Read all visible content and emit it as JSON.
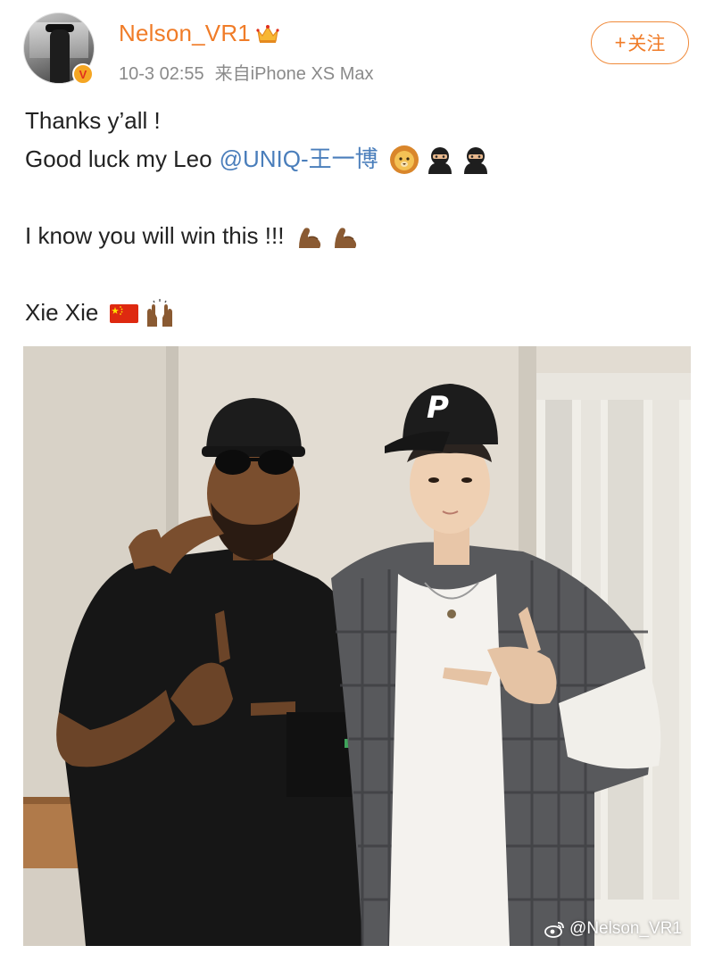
{
  "header": {
    "username": "Nelson_VR1",
    "username_color": "#f07c28",
    "badge_icon": "crown-icon",
    "verified_badge_letter": "V",
    "timestamp": "10-3 02:55",
    "source": "来自iPhone XS Max",
    "follow_label": "关注",
    "follow_plus": "+"
  },
  "post": {
    "line1": "Thanks y’all !",
    "line2_text": "Good luck my Leo",
    "line2_mention": "@UNIQ-王一博",
    "line2_emojis": [
      "lion-emoji",
      "ninja-emoji",
      "ninja-emoji"
    ],
    "line3_text": "I know you will win this !!!",
    "line3_emojis": [
      "flexed-biceps-emoji",
      "flexed-biceps-emoji"
    ],
    "line4_text": "Xie Xie",
    "line4_emojis": [
      "china-flag-emoji",
      "raising-hands-emoji"
    ],
    "mention_color": "#4a7ebb"
  },
  "photo": {
    "watermark": "@Nelson_VR1",
    "cap_logo_letter": "P"
  }
}
